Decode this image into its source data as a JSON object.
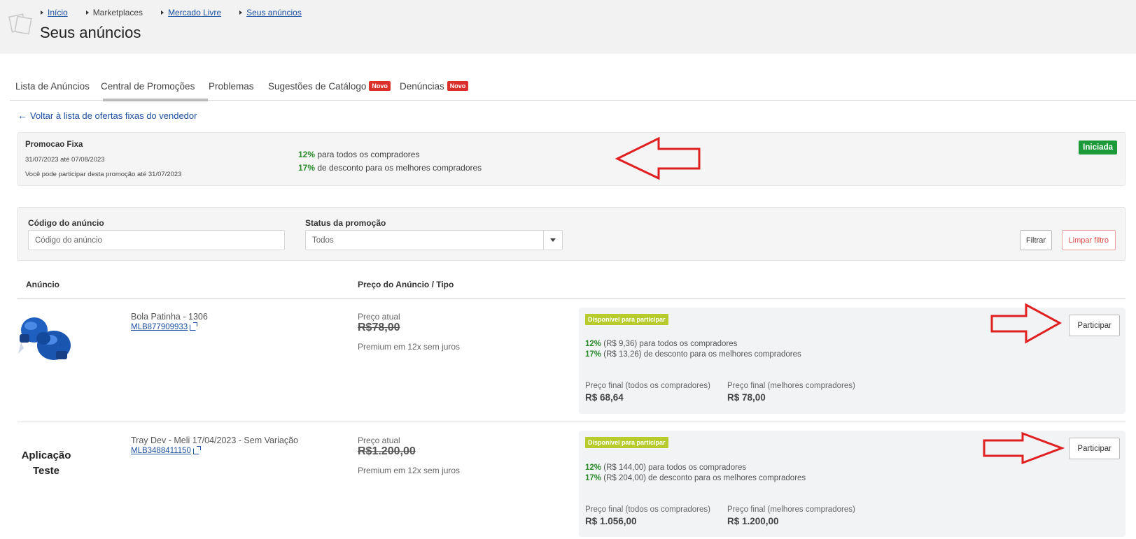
{
  "breadcrumb": [
    {
      "label": "Início",
      "link": true
    },
    {
      "label": "Marketplaces",
      "link": false
    },
    {
      "label": "Mercado Livre",
      "link": true
    },
    {
      "label": "Seus anúncios",
      "link": true
    }
  ],
  "page_title": "Seus anúncios",
  "tabs": [
    {
      "label": "Lista de Anúncios",
      "badge": ""
    },
    {
      "label": "Central de Promoções",
      "badge": "",
      "active": true
    },
    {
      "label": "Problemas",
      "badge": ""
    },
    {
      "label": "Sugestões de Catálogo",
      "badge": "Novo"
    },
    {
      "label": "Denúncias",
      "badge": "Novo"
    }
  ],
  "back_link": "Voltar à lista de ofertas fixas do vendedor",
  "promo": {
    "title": "Promocao Fixa",
    "dates": "31/07/2023 até 07/08/2023",
    "deadline": "Você pode participar desta promoção até 31/07/2023",
    "line1_pct": "12%",
    "line1_text": "para todos os compradores",
    "line2_pct": "17%",
    "line2_text": "de desconto para os melhores compradores",
    "status": "Iniciada",
    "status_color": "#1c9a3a"
  },
  "filter": {
    "code_label": "Código do anúncio",
    "code_placeholder": "Código do anúncio",
    "status_label": "Status da promoção",
    "status_value": "Todos",
    "btn_filter": "Filtrar",
    "btn_clear": "Limpar filtro"
  },
  "table": {
    "col_listing": "Anúncio",
    "col_price": "Preço do Anúncio / Tipo"
  },
  "rows": [
    {
      "name": "Bola Patinha - 1306",
      "code": "MLB877909933",
      "image": "blue-boxing-gloves",
      "price_label": "Preço atual",
      "price": "R$78,00",
      "price_type": "Premium em 12x sem juros",
      "tag": "Disponível para participar",
      "offer1_pct": "12%",
      "offer1_text": "(R$ 9,36) para todos os compradores",
      "offer2_pct": "17%",
      "offer2_text": "(R$ 13,26) de desconto para os melhores compradores",
      "final_all_label": "Preço final (todos os compradores)",
      "final_all": "R$ 68,64",
      "final_best_label": "Preço final (melhores compradores)",
      "final_best": "R$ 78,00",
      "btn": "Participar"
    },
    {
      "name": "Tray Dev - Meli 17/04/2023 - Sem Variação",
      "code": "MLB3488411150",
      "image_text": "Aplicação Teste",
      "price_label": "Preço atual",
      "price": "R$1.200,00",
      "price_type": "Premium em 12x sem juros",
      "tag": "Disponível para participar",
      "offer1_pct": "12%",
      "offer1_text": "(R$ 144,00) para todos os compradores",
      "offer2_pct": "17%",
      "offer2_text": "(R$ 204,00) de desconto para os melhores compradores",
      "final_all_label": "Preço final (todos os compradores)",
      "final_all": "R$ 1.056,00",
      "final_best_label": "Preço final (melhores compradores)",
      "final_best": "R$ 1.200,00",
      "btn": "Participar"
    }
  ],
  "colors": {
    "link": "#1a4fa0",
    "badge_new": "#d9302c",
    "available_tag": "#b7cb2d",
    "percent_green": "#2a8a2a",
    "annotation_arrow": "#e02020"
  }
}
